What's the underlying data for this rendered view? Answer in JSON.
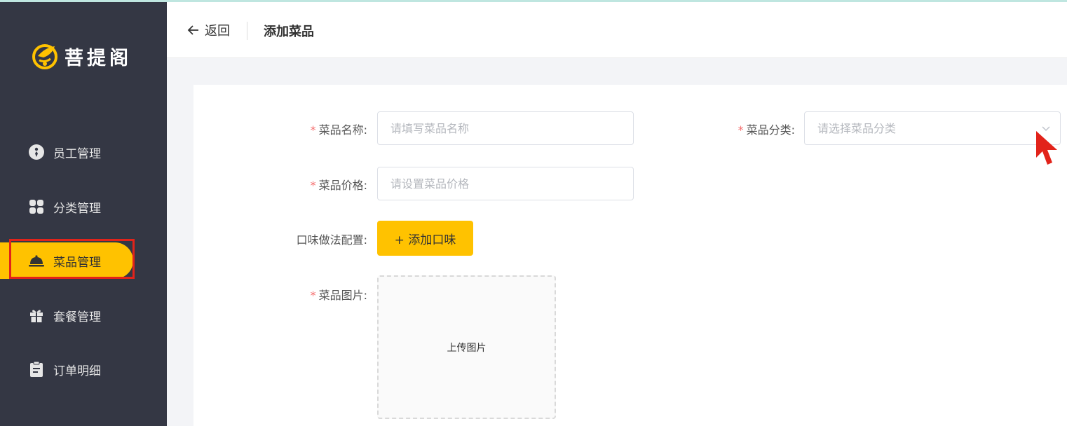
{
  "app": {
    "name": "菩提阁"
  },
  "sidebar": {
    "items": [
      {
        "label": "员工管理",
        "icon": "employee-icon",
        "active": false
      },
      {
        "label": "分类管理",
        "icon": "category-icon",
        "active": false
      },
      {
        "label": "菜品管理",
        "icon": "dish-icon",
        "active": true
      },
      {
        "label": "套餐管理",
        "icon": "gift-icon",
        "active": false
      },
      {
        "label": "订单明细",
        "icon": "clipboard-icon",
        "active": false
      }
    ]
  },
  "header": {
    "back_label": "返回",
    "title": "添加菜品"
  },
  "form": {
    "name": {
      "label": "菜品名称:",
      "placeholder": "请填写菜品名称",
      "required": true
    },
    "category": {
      "label": "菜品分类:",
      "placeholder": "请选择菜品分类",
      "required": true
    },
    "price": {
      "label": "菜品价格:",
      "placeholder": "请设置菜品价格",
      "required": true
    },
    "flavor": {
      "label": "口味做法配置:",
      "button": "+ 添加口味"
    },
    "image": {
      "label": "菜品图片:",
      "upload_text": "上传图片",
      "required": true
    }
  },
  "colors": {
    "sidebar_bg": "#343744",
    "accent": "#ffc200",
    "required": "#f56c6c",
    "highlight": "#e2231a"
  }
}
